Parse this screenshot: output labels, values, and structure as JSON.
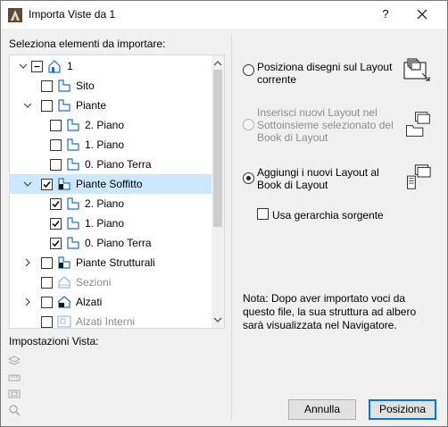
{
  "window": {
    "title": "Importa Viste da 1",
    "help_label": "?"
  },
  "left": {
    "select_label": "Seleziona elementi da importare:",
    "view_settings_label": "Impostazioni Vista:"
  },
  "tree": {
    "rows": [
      {
        "label": "1"
      },
      {
        "label": "Sito"
      },
      {
        "label": "Piante"
      },
      {
        "label": "2. Piano"
      },
      {
        "label": "1. Piano"
      },
      {
        "label": "0. Piano Terra"
      },
      {
        "label": "Piante Soffitto"
      },
      {
        "label": "2. Piano"
      },
      {
        "label": "1. Piano"
      },
      {
        "label": "0. Piano Terra"
      },
      {
        "label": "Piante Strutturali"
      },
      {
        "label": "Sezioni"
      },
      {
        "label": "Alzati"
      },
      {
        "label": "Alzati Interni"
      }
    ]
  },
  "options": {
    "opt1": "Posiziona disegni sul Layout corrente",
    "opt2": "Inserisci nuovi Layout nel Sottoinsieme selezionato del Book di Layout",
    "opt3": "Aggiungi i nuovi Layout al Book di Layout",
    "hierarchy_label": "Usa gerarchia sorgente",
    "selected_option": "opt3"
  },
  "note": "Nota: Dopo aver importato voci da questo file, la sua struttura ad albero sarà visualizzata nel Navigatore.",
  "buttons": {
    "cancel": "Annulla",
    "place": "Posiziona"
  },
  "colors": {
    "selection": "#cce8ff",
    "accent": "#0078d7",
    "icon_blue": "#1e6fd0"
  }
}
